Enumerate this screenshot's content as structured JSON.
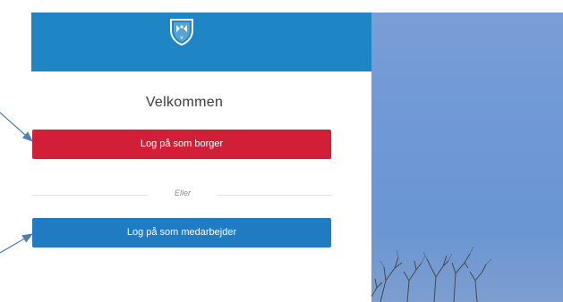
{
  "login": {
    "title": "Velkommen",
    "citizen_button": "Log på som borger",
    "divider_text": "Eller",
    "employee_button": "Log på som medarbejder"
  },
  "colors": {
    "header_blue": "#1f86c6",
    "citizen_red": "#d01f37",
    "employee_blue": "#1f7bc2",
    "arrow_blue": "#4a7fb8"
  },
  "icons": {
    "crest": "municipal-crest-icon"
  }
}
